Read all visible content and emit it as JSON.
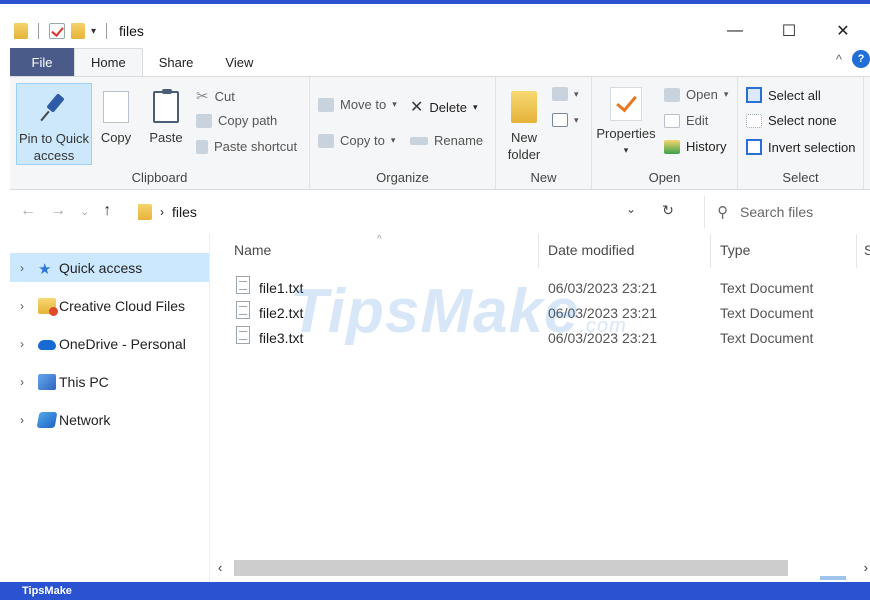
{
  "window": {
    "title": "files",
    "qat_caret": "▾",
    "minimize": "—",
    "maximize": "☐",
    "close": "✕"
  },
  "tabs": [
    {
      "label": "File"
    },
    {
      "label": "Home"
    },
    {
      "label": "Share"
    },
    {
      "label": "View"
    }
  ],
  "tab_right": {
    "collapse": "^",
    "help": "?"
  },
  "ribbon": {
    "clipboard": {
      "label": "Clipboard",
      "pin": "Pin to Quick access",
      "copy": "Copy",
      "paste": "Paste",
      "cut": "Cut",
      "copy_path": "Copy path",
      "paste_shortcut": "Paste shortcut"
    },
    "organize": {
      "label": "Organize",
      "move_to": "Move to",
      "copy_to": "Copy to",
      "delete": "Delete",
      "rename": "Rename"
    },
    "new": {
      "label": "New",
      "new_folder": "New folder"
    },
    "open": {
      "label": "Open",
      "properties": "Properties",
      "open": "Open",
      "edit": "Edit",
      "history": "History"
    },
    "select": {
      "label": "Select",
      "select_all": "Select all",
      "select_none": "Select none",
      "invert_selection": "Invert selection"
    }
  },
  "address": {
    "path": "files",
    "search_placeholder": "Search files"
  },
  "nav": [
    {
      "label": "Quick access",
      "icon": "star-icon",
      "selected": true
    },
    {
      "label": "Creative Cloud Files",
      "icon": "creative-cloud-icon"
    },
    {
      "label": "OneDrive - Personal",
      "icon": "onedrive-icon"
    },
    {
      "label": "This PC",
      "icon": "pc-icon"
    },
    {
      "label": "Network",
      "icon": "network-icon"
    }
  ],
  "columns": {
    "name": "Name",
    "date": "Date modified",
    "type": "Type",
    "size": "S"
  },
  "files": [
    {
      "name": "file1.txt",
      "date": "06/03/2023 23:21",
      "type": "Text Document"
    },
    {
      "name": "file2.txt",
      "date": "06/03/2023 23:21",
      "type": "Text Document"
    },
    {
      "name": "file3.txt",
      "date": "06/03/2023 23:21",
      "type": "Text Document"
    }
  ],
  "watermark": {
    "main": "TipsMake",
    "suffix": ".com"
  },
  "footer": {
    "brand": "TipsMake"
  },
  "colors": {
    "accent": "#2b53d1",
    "file_tab": "#4a5a89",
    "selected": "#cce8ff"
  }
}
